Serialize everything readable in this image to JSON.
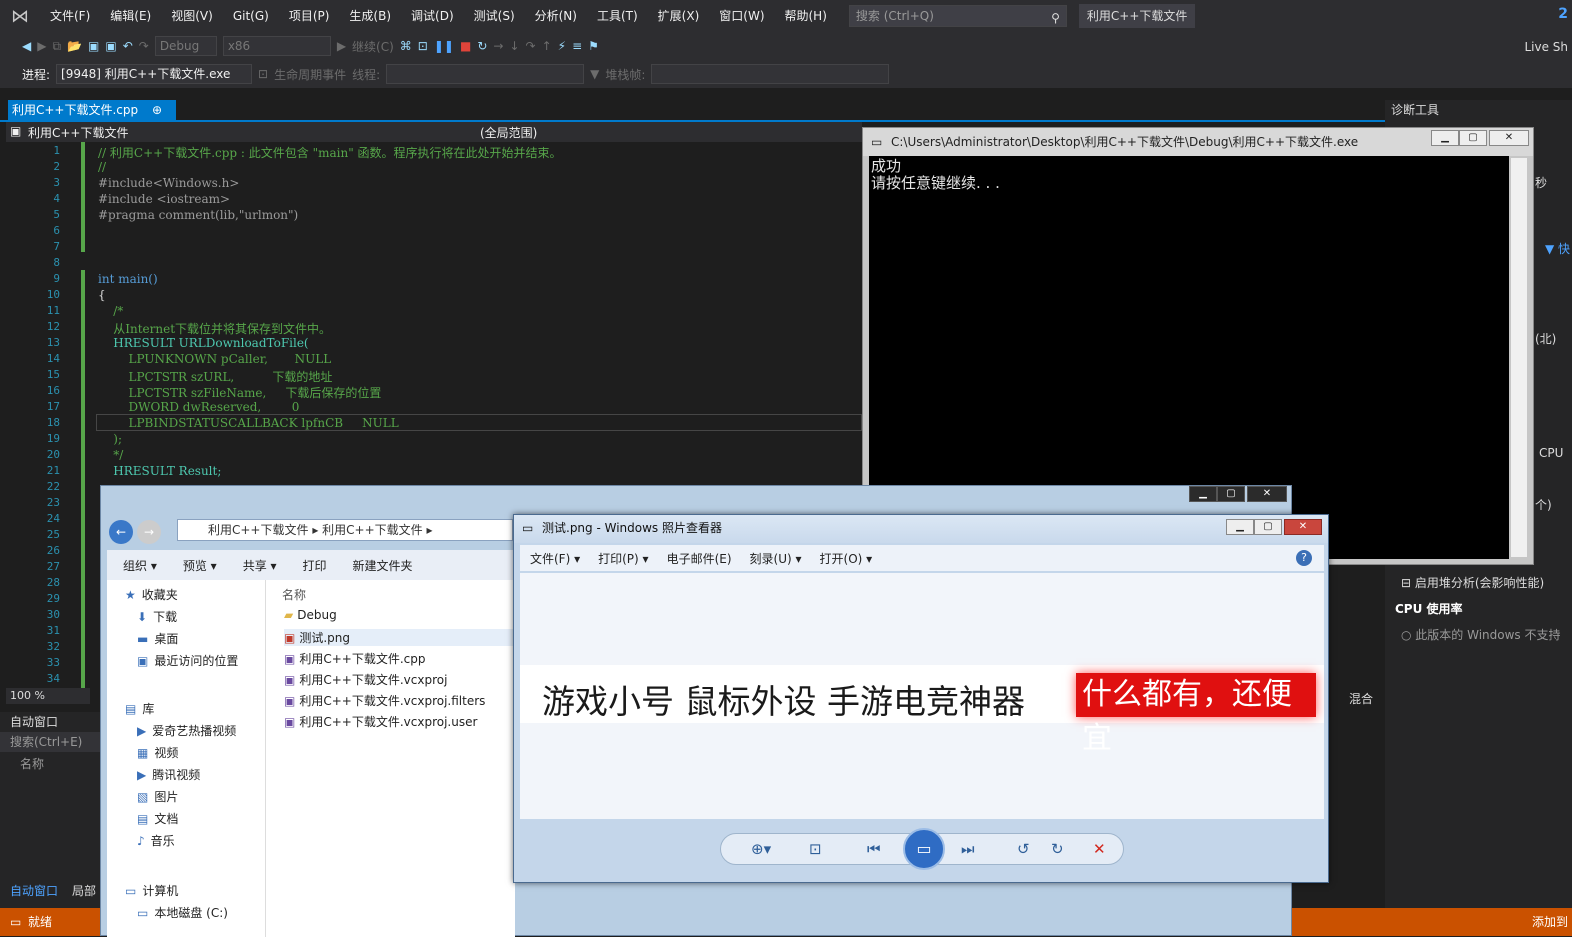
{
  "menubar": {
    "items": [
      "文件(F)",
      "编辑(E)",
      "视图(V)",
      "Git(G)",
      "项目(P)",
      "生成(B)",
      "调试(D)",
      "测试(S)",
      "分析(N)",
      "工具(T)",
      "扩展(X)",
      "窗口(W)",
      "帮助(H)"
    ],
    "search_placeholder": "搜索 (Ctrl+Q)",
    "window_title": "利用C++下载文件",
    "badge": "2"
  },
  "toolbar": {
    "config": "Debug",
    "platform": "x86",
    "continue": "继续(C)",
    "live_share": "Live Sh"
  },
  "toolbar2": {
    "process_label": "进程:",
    "process_value": "[9948] 利用C++下载文件.exe",
    "lifecycle": "生命周期事件",
    "thread": "线程:",
    "stackframe": "堆栈帧:"
  },
  "doc_tab": {
    "label": "利用C++下载文件.cpp",
    "pin": "⊕",
    "close": "×"
  },
  "nav_bar": {
    "project": "利用C++下载文件",
    "scope": "(全局范围)"
  },
  "editor_lines": [
    {
      "n": "1",
      "t": "// 利用C++下载文件.cpp : 此文件包含 \"main\" 函数。程序执行将在此处开始并结束。"
    },
    {
      "n": "2",
      "t": "//"
    },
    {
      "n": "3",
      "t": "#include<Windows.h>"
    },
    {
      "n": "4",
      "t": "#include <iostream>"
    },
    {
      "n": "5",
      "t": "#pragma comment(lib,\"urlmon\")"
    },
    {
      "n": "6",
      "t": ""
    },
    {
      "n": "7",
      "t": ""
    },
    {
      "n": "8",
      "t": ""
    },
    {
      "n": "9",
      "t": "int main()"
    },
    {
      "n": "10",
      "t": "{"
    },
    {
      "n": "11",
      "t": "    /*"
    },
    {
      "n": "12",
      "t": "    从Internet下载位并将其保存到文件中。"
    },
    {
      "n": "13",
      "t": "    HRESULT URLDownloadToFile("
    },
    {
      "n": "14",
      "t": "        LPUNKNOWN pCaller,       NULL"
    },
    {
      "n": "15",
      "t": "        LPCTSTR szURL,          下载的地址"
    },
    {
      "n": "16",
      "t": "        LPCTSTR szFileName,     下载后保存的位置"
    },
    {
      "n": "17",
      "t": "        DWORD dwReserved,        0"
    },
    {
      "n": "18",
      "t": "        LPBINDSTATUSCALLBACK lpfnCB     NULL"
    },
    {
      "n": "19",
      "t": "    );"
    },
    {
      "n": "20",
      "t": "    */"
    },
    {
      "n": "21",
      "t": "    HRESULT Result;"
    },
    {
      "n": "22",
      "t": ""
    },
    {
      "n": "23",
      "t": ""
    },
    {
      "n": "24",
      "t": ""
    },
    {
      "n": "25",
      "t": ""
    },
    {
      "n": "26",
      "t": ""
    },
    {
      "n": "27",
      "t": ""
    },
    {
      "n": "28",
      "t": ""
    },
    {
      "n": "29",
      "t": ""
    },
    {
      "n": "30",
      "t": ""
    },
    {
      "n": "31",
      "t": ""
    },
    {
      "n": "32",
      "t": ""
    },
    {
      "n": "33",
      "t": ""
    },
    {
      "n": "34",
      "t": ""
    }
  ],
  "zoom": "100 %",
  "auto_window": {
    "title": "自动窗口",
    "search": "搜索(Ctrl+E)",
    "col_name": "名称",
    "tab1": "自动窗口",
    "tab2": "局部"
  },
  "status": {
    "text": "就绪",
    "right": "添加到"
  },
  "diagnostics": {
    "title": "诊断工具",
    "s1": "秒",
    "s2": "▼ 快",
    "s3": "(北)",
    "s4": "CPU",
    "s5": "个)",
    "heap": "启用堆分析(会影响性能)",
    "cpu_title": "CPU 使用率",
    "cpu_note": "此版本的 Windows 不支持",
    "mix": "混合"
  },
  "console": {
    "title": "C:\\Users\\Administrator\\Desktop\\利用C++下载文件\\Debug\\利用C++下载文件.exe",
    "line1": "成功",
    "line2": "请按任意键继续. . ."
  },
  "explorer": {
    "breadcrumb": [
      "利用C++下载文件",
      "利用C++下载文件"
    ],
    "commands": [
      "组织 ▾",
      "预览 ▾",
      "共享 ▾",
      "打印",
      "新建文件夹"
    ],
    "tree": [
      "收藏夹",
      "下载",
      "桌面",
      "最近访问的位置",
      "库",
      "爱奇艺热播视频",
      "视频",
      "腾讯视频",
      "图片",
      "文档",
      "音乐",
      "计算机",
      "本地磁盘 (C:)"
    ],
    "col_name": "名称",
    "files": [
      "Debug",
      "测试.png",
      "利用C++下载文件.cpp",
      "利用C++下载文件.vcxproj",
      "利用C++下载文件.vcxproj.filters",
      "利用C++下载文件.vcxproj.user"
    ]
  },
  "photo_viewer": {
    "title": "测试.png - Windows 照片查看器",
    "menu": [
      "文件(F) ▾",
      "打印(P) ▾",
      "电子邮件(E)",
      "刻录(U) ▾",
      "打开(O) ▾"
    ],
    "banner_black": "游戏小号 鼠标外设 手游电竞神器",
    "banner_red": "什么都有，还便宜"
  }
}
